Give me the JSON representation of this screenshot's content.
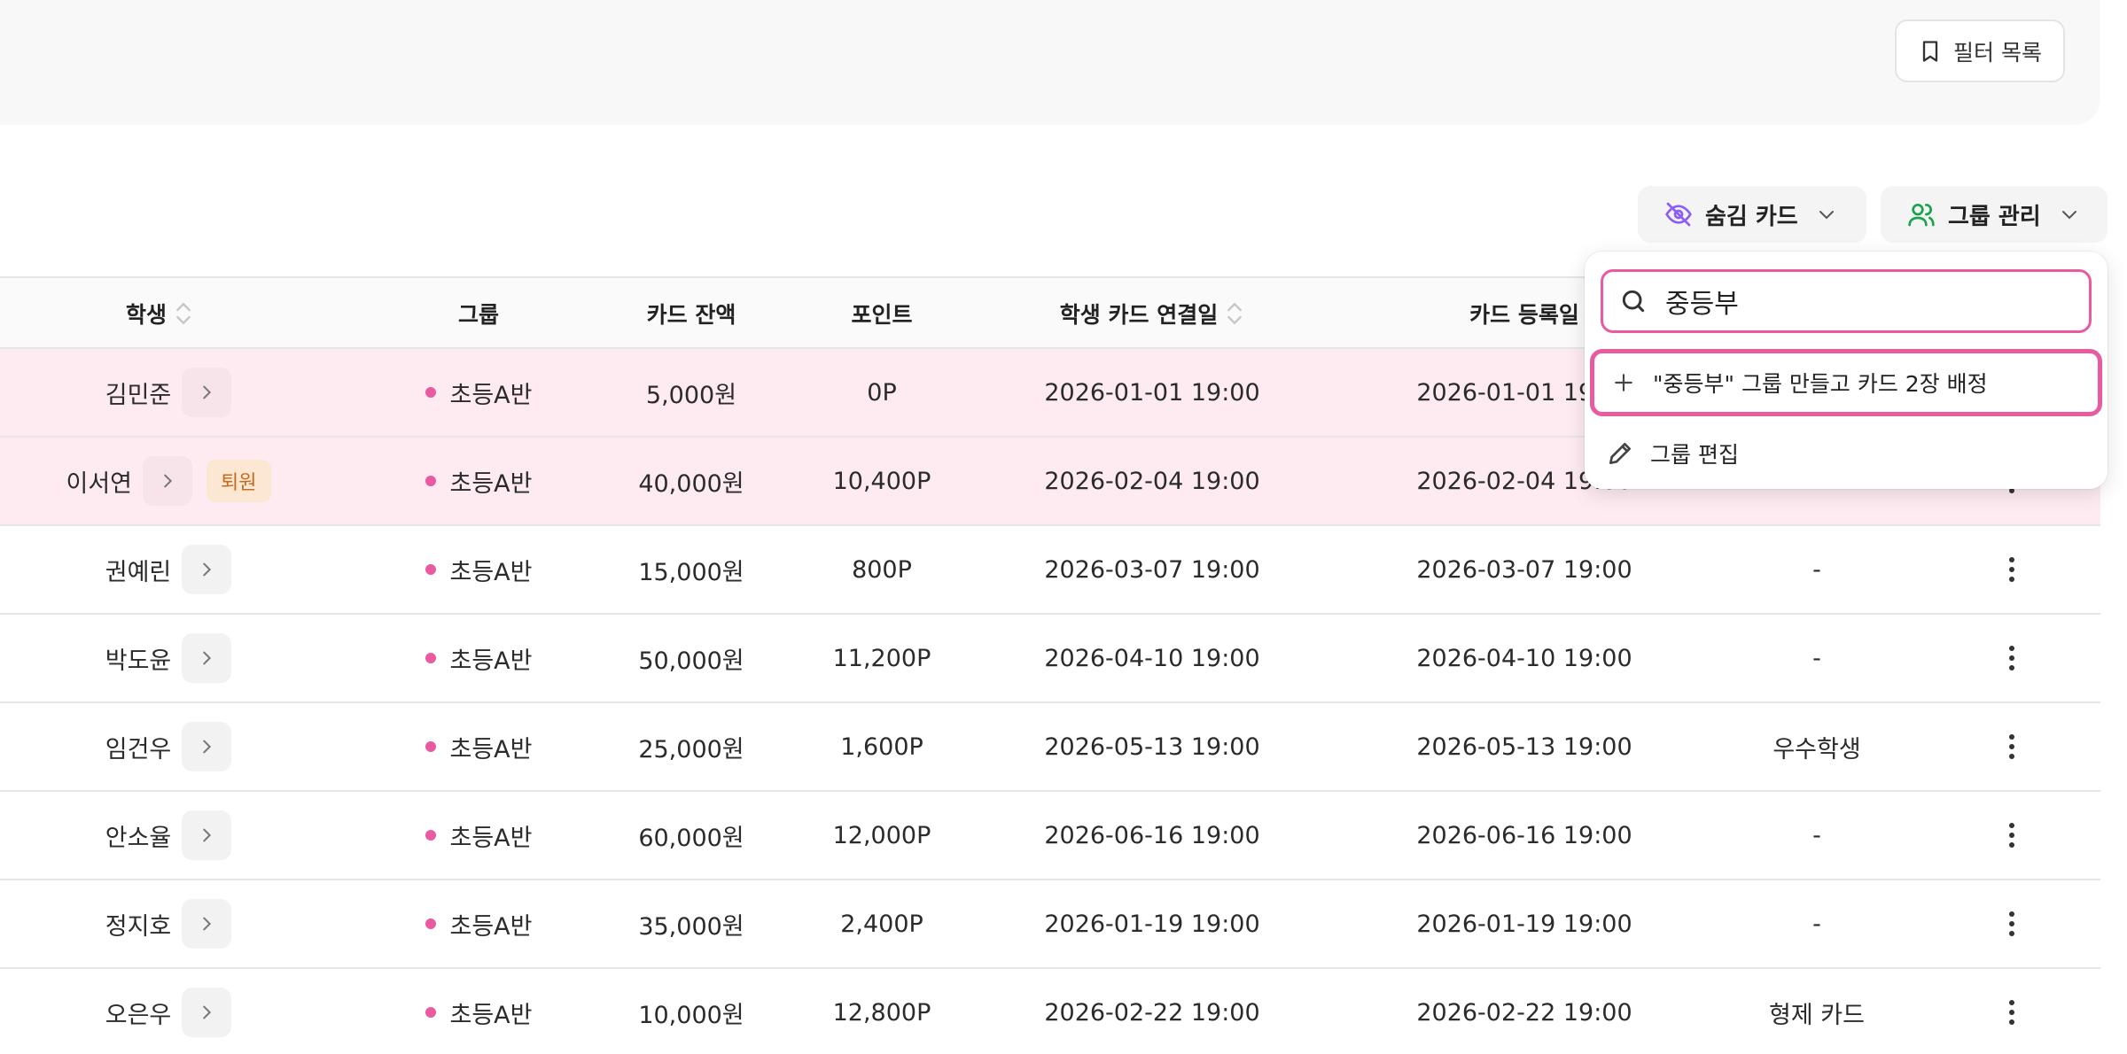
{
  "filter_panel": {
    "filter_list_label": "필터 목록"
  },
  "toolbar": {
    "hidden_cards_label": "숨김 카드",
    "group_manage_label": "그룹 관리"
  },
  "table": {
    "headers": {
      "student": "학생",
      "group": "그룹",
      "balance": "카드 잔액",
      "points": "포인트",
      "linked_date": "학생 카드 연결일",
      "registered_date": "카드 등록일"
    },
    "rows": [
      {
        "name": "김민준",
        "badge": "",
        "group": "초등A반",
        "balance": "5,000원",
        "points": "0P",
        "linked": "2026-01-01 19:00",
        "registered": "2026-01-01 19:00",
        "memo": "",
        "selected": true
      },
      {
        "name": "이서연",
        "badge": "퇴원",
        "group": "초등A반",
        "balance": "40,000원",
        "points": "10,400P",
        "linked": "2026-02-04 19:00",
        "registered": "2026-02-04 19:00",
        "memo": "",
        "selected": true
      },
      {
        "name": "권예린",
        "badge": "",
        "group": "초등A반",
        "balance": "15,000원",
        "points": "800P",
        "linked": "2026-03-07 19:00",
        "registered": "2026-03-07 19:00",
        "memo": "-",
        "selected": false
      },
      {
        "name": "박도윤",
        "badge": "",
        "group": "초등A반",
        "balance": "50,000원",
        "points": "11,200P",
        "linked": "2026-04-10 19:00",
        "registered": "2026-04-10 19:00",
        "memo": "-",
        "selected": false
      },
      {
        "name": "임건우",
        "badge": "",
        "group": "초등A반",
        "balance": "25,000원",
        "points": "1,600P",
        "linked": "2026-05-13 19:00",
        "registered": "2026-05-13 19:00",
        "memo": "우수학생",
        "selected": false
      },
      {
        "name": "안소율",
        "badge": "",
        "group": "초등A반",
        "balance": "60,000원",
        "points": "12,000P",
        "linked": "2026-06-16 19:00",
        "registered": "2026-06-16 19:00",
        "memo": "-",
        "selected": false
      },
      {
        "name": "정지호",
        "badge": "",
        "group": "초등A반",
        "balance": "35,000원",
        "points": "2,400P",
        "linked": "2026-01-19 19:00",
        "registered": "2026-01-19 19:00",
        "memo": "-",
        "selected": false
      },
      {
        "name": "오은우",
        "badge": "",
        "group": "초등A반",
        "balance": "10,000원",
        "points": "12,800P",
        "linked": "2026-02-22 19:00",
        "registered": "2026-02-22 19:00",
        "memo": "형제 카드",
        "selected": false
      }
    ]
  },
  "dropdown": {
    "search_value": "중등부",
    "create_option_label": "\"중등부\" 그룹 만들고 카드 2장 배정",
    "edit_option_label": "그룹 편집"
  },
  "colors": {
    "accent": "#ea5aa0",
    "selected_row": "#fdebf1",
    "hidden_icon": "#8b5cf6",
    "group_icon": "#16a34a"
  }
}
